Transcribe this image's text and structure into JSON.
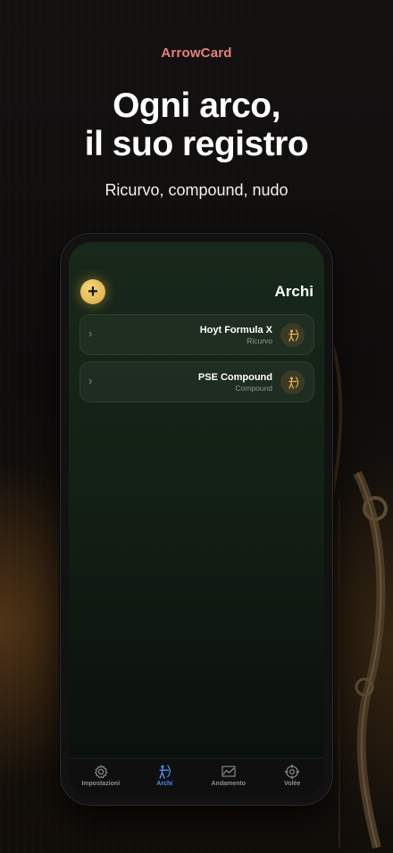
{
  "brand": "ArrowCard",
  "headline": {
    "line1": "Ogni arco,",
    "line2": "il suo registro"
  },
  "subline": "Ricurvo, compound, nudo",
  "screen": {
    "title": "Archi",
    "add_label": "+",
    "bows": [
      {
        "name": "Hoyt Formula X",
        "type": "Ricurvo",
        "icon": "archer-icon"
      },
      {
        "name": "PSE Compound",
        "type": "Compound",
        "icon": "archer-icon"
      }
    ],
    "chevron": "›"
  },
  "tabbar": {
    "tabs": [
      {
        "label": "Impostazioni",
        "icon": "gear-icon",
        "active": false
      },
      {
        "label": "Archi",
        "icon": "archer-icon",
        "active": true
      },
      {
        "label": "Andamento",
        "icon": "chart-icon",
        "active": false
      },
      {
        "label": "Volée",
        "icon": "target-icon",
        "active": false
      }
    ]
  },
  "colors": {
    "brand": "#e8807a",
    "accent_gold": "#e3b54d",
    "active_tab": "#4f8ef5",
    "screen_bg": "#132015"
  }
}
